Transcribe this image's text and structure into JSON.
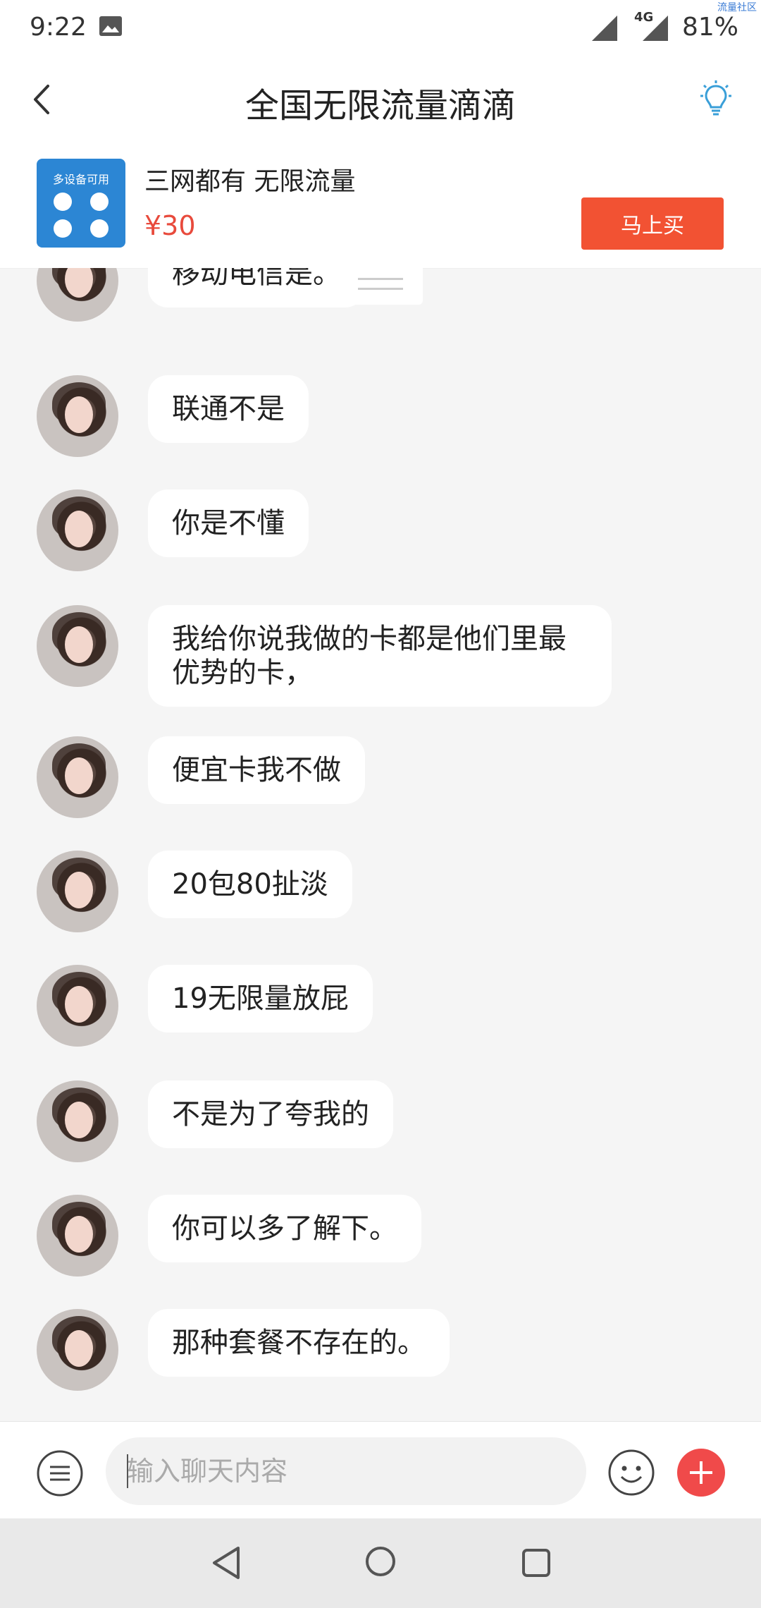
{
  "status_bar": {
    "time": "9:22",
    "network": "4G",
    "battery": "81%",
    "watermark": "流量社区"
  },
  "header": {
    "title": "全国无限流量滴滴",
    "icons": [
      "back-icon",
      "lightbulb-icon"
    ]
  },
  "product": {
    "thumb_text": "多设备可用",
    "name": "三网都有 无限流量",
    "price": "¥30",
    "buy_label": "马上买"
  },
  "messages": [
    {
      "text": "移动电信是。"
    },
    {
      "text": "联通不是"
    },
    {
      "text": "你是不懂"
    },
    {
      "text": "我给你说我做的卡都是他们里最优势的卡，"
    },
    {
      "text": "便宜卡我不做"
    },
    {
      "text": "20包80扯淡"
    },
    {
      "text": "19无限量放屁"
    },
    {
      "text": "不是为了夸我的"
    },
    {
      "text": "你可以多了解下。"
    },
    {
      "text": "那种套餐不存在的。"
    }
  ],
  "input": {
    "placeholder": "输入聊天内容",
    "value": "",
    "icons": [
      "menu-icon",
      "emoji-icon",
      "plus-icon"
    ]
  },
  "colors": {
    "accent": "#f25233",
    "price": "#e84a3c",
    "plus": "#f04a4a",
    "bulb": "#3a9fd8"
  }
}
